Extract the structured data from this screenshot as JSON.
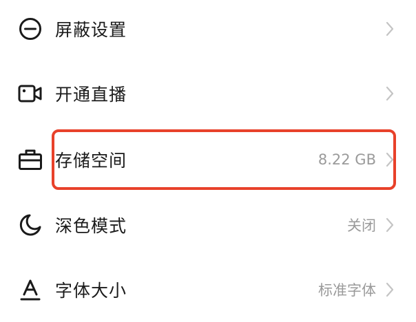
{
  "settings": {
    "items": [
      {
        "label": "屏蔽设置",
        "value": "",
        "icon": "block-icon"
      },
      {
        "label": "开通直播",
        "value": "",
        "icon": "video-camera-icon"
      },
      {
        "label": "存储空间",
        "value": "8.22 GB",
        "icon": "storage-box-icon"
      },
      {
        "label": "深色模式",
        "value": "关闭",
        "icon": "moon-icon"
      },
      {
        "label": "字体大小",
        "value": "标准字体",
        "icon": "font-size-icon"
      }
    ]
  },
  "colors": {
    "highlight": "#e8412a",
    "text": "#1a1a1a",
    "secondary": "#9a9a9a",
    "chevron": "#c4c4c4"
  }
}
